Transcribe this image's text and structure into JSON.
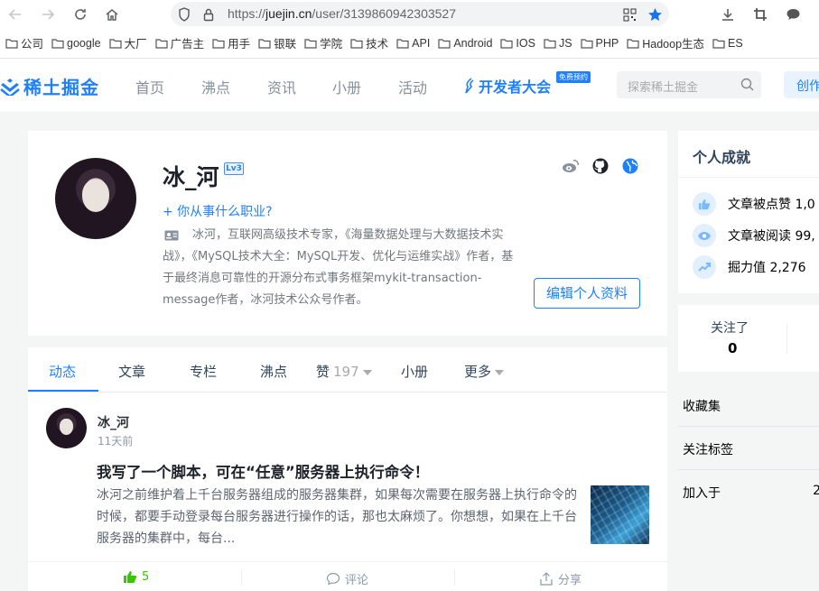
{
  "browser": {
    "url_scheme": "https://",
    "url_domain": "juejin.cn",
    "url_path": "/user/3139860942303527"
  },
  "bookmarks": [
    "公司",
    "google",
    "大厂",
    "广告主",
    "用手",
    "银联",
    "学院",
    "技术",
    "API",
    "Android",
    "IOS",
    "JS",
    "PHP",
    "Hadoop生态",
    "ES"
  ],
  "header": {
    "logo_text": "稀土掘金",
    "nav": [
      "首页",
      "沸点",
      "资讯",
      "小册",
      "活动"
    ],
    "devcon_text": "开发者大会",
    "devcon_badge": "免费预约",
    "search_placeholder": "探索稀土掘金",
    "create_label": "创作"
  },
  "profile": {
    "name": "冰_河",
    "level": "Lv3",
    "job_prompt": "+ 你从事什么职业?",
    "bio": "冰河，互联网高级技术专家，《海量数据处理与大数据技术实战》，《MySQL技术大全：MySQL开发、优化与运维实战》作者，基于最终消息可靠性的开源分布式事务框架mykit-transaction-message作者，冰河技术公众号作者。",
    "edit_label": "编辑个人资料"
  },
  "tabs": {
    "dynamic": "动态",
    "articles": "文章",
    "columns": "专栏",
    "pins": "沸点",
    "likes": "赞",
    "likes_count": "197",
    "booklets": "小册",
    "more": "更多"
  },
  "post": {
    "author": "冰_河",
    "time": "11天前",
    "title": "我写了一个脚本，可在“任意”服务器上执行命令！",
    "excerpt": "冰河之前维护着上千台服务器组成的服务器集群，如果每次需要在服务器上执行命令的时候，都要手动登录每台服务器进行操作的话，那也太麻烦了。你想想，如果在上千台服务器的集群中，每台...",
    "likes": "5",
    "comment_label": "评论",
    "share_label": "分享"
  },
  "sidebar": {
    "achievements_title": "个人成就",
    "likes_text": "文章被点赞 1,0",
    "reads_text": "文章被阅读 99,",
    "power_text": "掘力值 2,276",
    "following_label": "关注了",
    "following_count": "0",
    "collections_label": "收藏集",
    "tags_label": "关注标签",
    "joined_label": "加入于",
    "joined_value": "2"
  },
  "colors": {
    "brand": "#1e80ff",
    "like_green": "#37c700"
  }
}
